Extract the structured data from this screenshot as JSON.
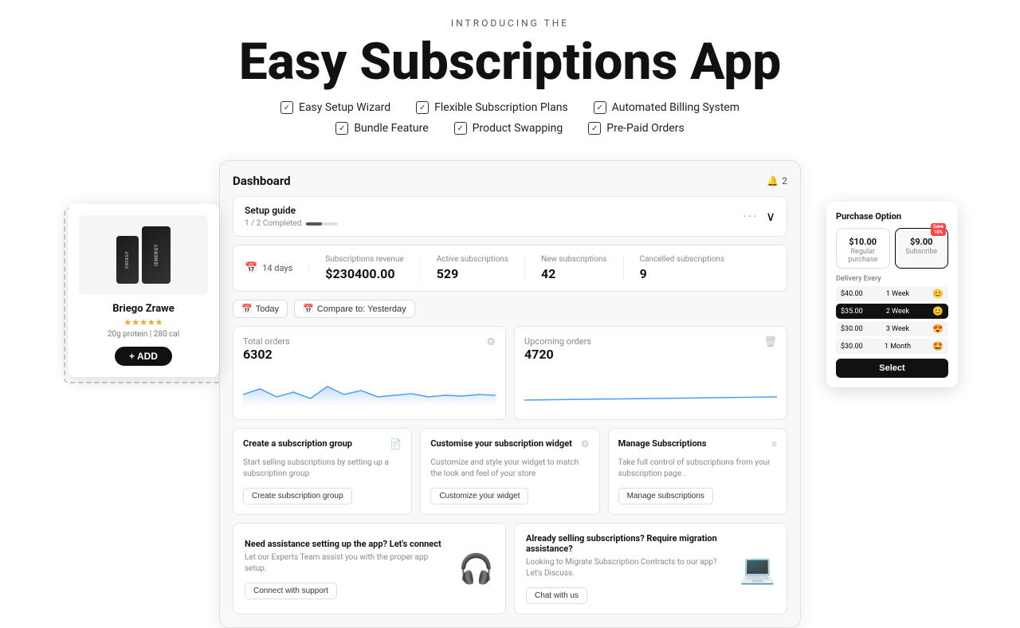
{
  "header": {
    "intro": "INTRODUCING THE",
    "title": "Easy Subscriptions App",
    "features_row1": [
      {
        "id": "easy-setup",
        "label": "Easy Setup Wizard"
      },
      {
        "id": "flexible-plans",
        "label": "Flexible Subscription Plans"
      },
      {
        "id": "automated-billing",
        "label": "Automated Billing System"
      }
    ],
    "features_row2": [
      {
        "id": "bundle",
        "label": "Bundle Feature"
      },
      {
        "id": "product-swap",
        "label": "Product Swapping"
      },
      {
        "id": "prepaid",
        "label": "Pre-Paid Orders"
      }
    ]
  },
  "dashboard": {
    "title": "Dashboard",
    "bell_count": "2",
    "setup_guide": {
      "title": "Setup guide",
      "progress_text": "1 / 2 Completed"
    },
    "stats": {
      "period": "14 days",
      "revenue_label": "Subscriptions revenue",
      "revenue_value": "$230400.00",
      "active_label": "Active subscriptions",
      "active_value": "529",
      "new_label": "New subscriptions",
      "new_value": "42",
      "cancelled_label": "Cancelled subscriptions",
      "cancelled_value": "9"
    },
    "date_buttons": [
      "Today",
      "Compare to: Yesterday"
    ],
    "total_orders": {
      "label": "Total orders",
      "value": "6302"
    },
    "upcoming_orders": {
      "label": "Upcoming orders",
      "value": "4720"
    },
    "action_cards": [
      {
        "title": "Create a subscription group",
        "desc": "Start selling subscriptions by setting up a subscription group",
        "btn": "Create subscription group"
      },
      {
        "title": "Customise your subscription widget",
        "desc": "Customize and style your widget to match the look and feel of your store",
        "btn": "Customize your widget"
      },
      {
        "title": "Manage Subscriptions",
        "desc": "Take full control of subscriptions from your subscription page .",
        "btn": "Manage subscriptions"
      }
    ],
    "support_cards": [
      {
        "title": "Need assistance setting up the app? Let's connect",
        "desc": "Let our Experts Team assist you with the proper app setup.",
        "btn": "Connect with support",
        "illustration": "🎧"
      },
      {
        "title": "Already selling subscriptions? Require migration assistance?",
        "desc": "Looking to Migrate Subscription Contracts to our app? Let's Discuss.",
        "btn": "Chat with us",
        "illustration": "💻"
      }
    ]
  },
  "product_card": {
    "name": "Briego Zrawe",
    "stars": "★★★★★",
    "meta": "20g protein | 280 cal",
    "add_btn": "+ ADD"
  },
  "purchase_card": {
    "title": "Purchase Option",
    "options": [
      {
        "label": "Regular purchase",
        "value": "$10.00",
        "save": null,
        "selected": false
      },
      {
        "label": "Subscribe",
        "value": "$9.00",
        "save": "Save\n10%",
        "selected": true
      }
    ],
    "delivery_label": "Delivery Every",
    "delivery_rows": [
      {
        "price": "$40.00",
        "period": "1 Week",
        "emoji": "😊",
        "active": false
      },
      {
        "price": "$35.00",
        "period": "2 Week",
        "emoji": "😊",
        "active": true
      },
      {
        "price": "$30.00",
        "period": "3 Week",
        "emoji": "😍",
        "active": false
      },
      {
        "price": "$30.00",
        "period": "1 Month",
        "emoji": "🤩",
        "active": false
      }
    ],
    "select_btn": "Select"
  }
}
